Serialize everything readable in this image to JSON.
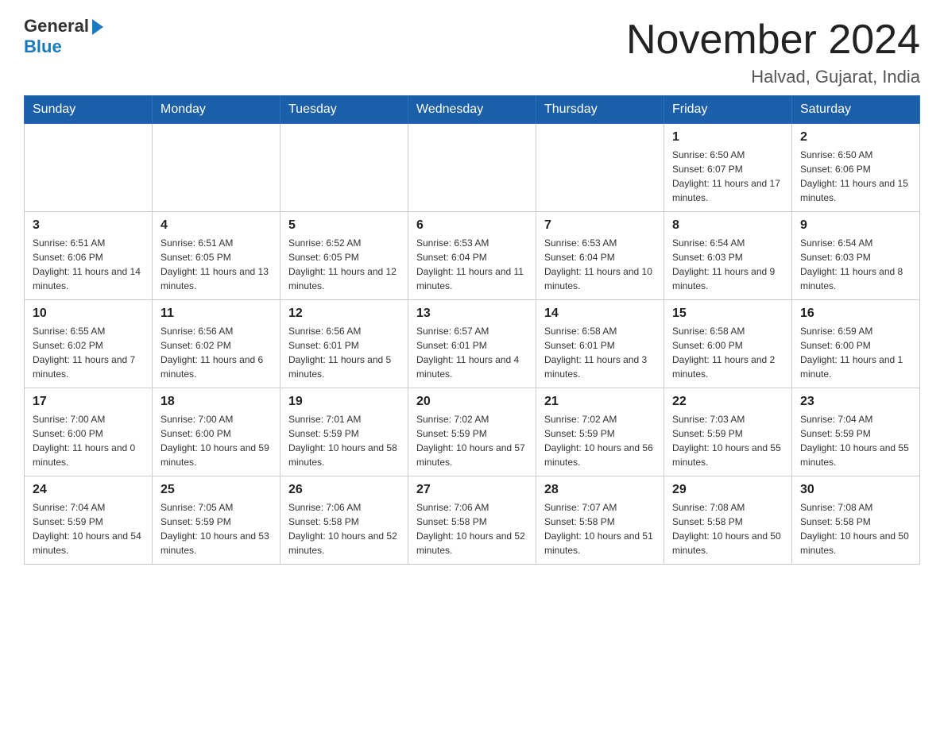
{
  "logo": {
    "general": "General",
    "blue": "Blue"
  },
  "calendar": {
    "title": "November 2024",
    "subtitle": "Halvad, Gujarat, India"
  },
  "weekdays": [
    "Sunday",
    "Monday",
    "Tuesday",
    "Wednesday",
    "Thursday",
    "Friday",
    "Saturday"
  ],
  "weeks": [
    [
      {
        "day": "",
        "info": ""
      },
      {
        "day": "",
        "info": ""
      },
      {
        "day": "",
        "info": ""
      },
      {
        "day": "",
        "info": ""
      },
      {
        "day": "",
        "info": ""
      },
      {
        "day": "1",
        "info": "Sunrise: 6:50 AM\nSunset: 6:07 PM\nDaylight: 11 hours and 17 minutes."
      },
      {
        "day": "2",
        "info": "Sunrise: 6:50 AM\nSunset: 6:06 PM\nDaylight: 11 hours and 15 minutes."
      }
    ],
    [
      {
        "day": "3",
        "info": "Sunrise: 6:51 AM\nSunset: 6:06 PM\nDaylight: 11 hours and 14 minutes."
      },
      {
        "day": "4",
        "info": "Sunrise: 6:51 AM\nSunset: 6:05 PM\nDaylight: 11 hours and 13 minutes."
      },
      {
        "day": "5",
        "info": "Sunrise: 6:52 AM\nSunset: 6:05 PM\nDaylight: 11 hours and 12 minutes."
      },
      {
        "day": "6",
        "info": "Sunrise: 6:53 AM\nSunset: 6:04 PM\nDaylight: 11 hours and 11 minutes."
      },
      {
        "day": "7",
        "info": "Sunrise: 6:53 AM\nSunset: 6:04 PM\nDaylight: 11 hours and 10 minutes."
      },
      {
        "day": "8",
        "info": "Sunrise: 6:54 AM\nSunset: 6:03 PM\nDaylight: 11 hours and 9 minutes."
      },
      {
        "day": "9",
        "info": "Sunrise: 6:54 AM\nSunset: 6:03 PM\nDaylight: 11 hours and 8 minutes."
      }
    ],
    [
      {
        "day": "10",
        "info": "Sunrise: 6:55 AM\nSunset: 6:02 PM\nDaylight: 11 hours and 7 minutes."
      },
      {
        "day": "11",
        "info": "Sunrise: 6:56 AM\nSunset: 6:02 PM\nDaylight: 11 hours and 6 minutes."
      },
      {
        "day": "12",
        "info": "Sunrise: 6:56 AM\nSunset: 6:01 PM\nDaylight: 11 hours and 5 minutes."
      },
      {
        "day": "13",
        "info": "Sunrise: 6:57 AM\nSunset: 6:01 PM\nDaylight: 11 hours and 4 minutes."
      },
      {
        "day": "14",
        "info": "Sunrise: 6:58 AM\nSunset: 6:01 PM\nDaylight: 11 hours and 3 minutes."
      },
      {
        "day": "15",
        "info": "Sunrise: 6:58 AM\nSunset: 6:00 PM\nDaylight: 11 hours and 2 minutes."
      },
      {
        "day": "16",
        "info": "Sunrise: 6:59 AM\nSunset: 6:00 PM\nDaylight: 11 hours and 1 minute."
      }
    ],
    [
      {
        "day": "17",
        "info": "Sunrise: 7:00 AM\nSunset: 6:00 PM\nDaylight: 11 hours and 0 minutes."
      },
      {
        "day": "18",
        "info": "Sunrise: 7:00 AM\nSunset: 6:00 PM\nDaylight: 10 hours and 59 minutes."
      },
      {
        "day": "19",
        "info": "Sunrise: 7:01 AM\nSunset: 5:59 PM\nDaylight: 10 hours and 58 minutes."
      },
      {
        "day": "20",
        "info": "Sunrise: 7:02 AM\nSunset: 5:59 PM\nDaylight: 10 hours and 57 minutes."
      },
      {
        "day": "21",
        "info": "Sunrise: 7:02 AM\nSunset: 5:59 PM\nDaylight: 10 hours and 56 minutes."
      },
      {
        "day": "22",
        "info": "Sunrise: 7:03 AM\nSunset: 5:59 PM\nDaylight: 10 hours and 55 minutes."
      },
      {
        "day": "23",
        "info": "Sunrise: 7:04 AM\nSunset: 5:59 PM\nDaylight: 10 hours and 55 minutes."
      }
    ],
    [
      {
        "day": "24",
        "info": "Sunrise: 7:04 AM\nSunset: 5:59 PM\nDaylight: 10 hours and 54 minutes."
      },
      {
        "day": "25",
        "info": "Sunrise: 7:05 AM\nSunset: 5:59 PM\nDaylight: 10 hours and 53 minutes."
      },
      {
        "day": "26",
        "info": "Sunrise: 7:06 AM\nSunset: 5:58 PM\nDaylight: 10 hours and 52 minutes."
      },
      {
        "day": "27",
        "info": "Sunrise: 7:06 AM\nSunset: 5:58 PM\nDaylight: 10 hours and 52 minutes."
      },
      {
        "day": "28",
        "info": "Sunrise: 7:07 AM\nSunset: 5:58 PM\nDaylight: 10 hours and 51 minutes."
      },
      {
        "day": "29",
        "info": "Sunrise: 7:08 AM\nSunset: 5:58 PM\nDaylight: 10 hours and 50 minutes."
      },
      {
        "day": "30",
        "info": "Sunrise: 7:08 AM\nSunset: 5:58 PM\nDaylight: 10 hours and 50 minutes."
      }
    ]
  ]
}
